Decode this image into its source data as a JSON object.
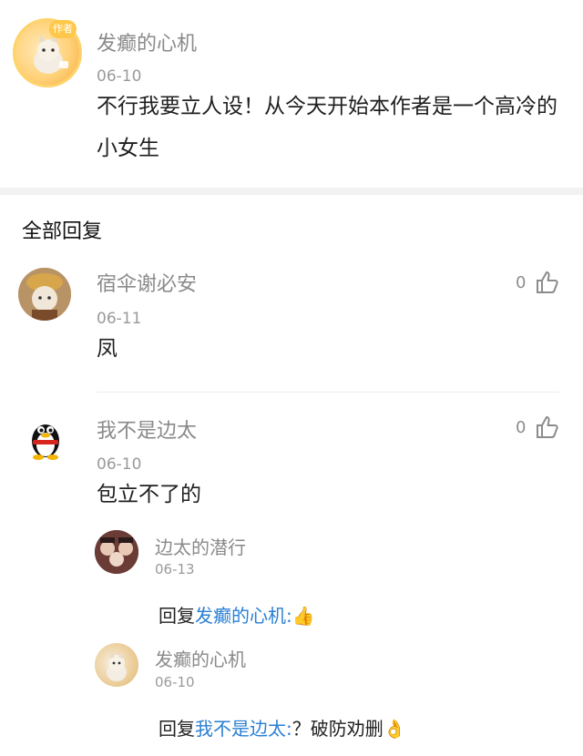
{
  "post": {
    "author": "发癫的心机",
    "badge": "作者",
    "date": "06-10",
    "content": "不行我要立人设！从今天开始本作者是一个高冷的小女生"
  },
  "section_title": "全部回复",
  "comments": [
    {
      "author": "宿伞谢必安",
      "date": "06-11",
      "content": "凤",
      "likes": "0"
    },
    {
      "author": "我不是边太",
      "date": "06-10",
      "content": "包立不了的",
      "likes": "0",
      "replies": [
        {
          "author": "边太的潜行",
          "date": "06-13",
          "prefix": "回复",
          "mention": "发癫的心机",
          "colon": ":",
          "text": "👍"
        },
        {
          "author": "发癫的心机",
          "date": "06-10",
          "prefix": "回复",
          "mention": "我不是边太",
          "colon": ":",
          "text": "？破防劝删👌"
        }
      ]
    }
  ]
}
